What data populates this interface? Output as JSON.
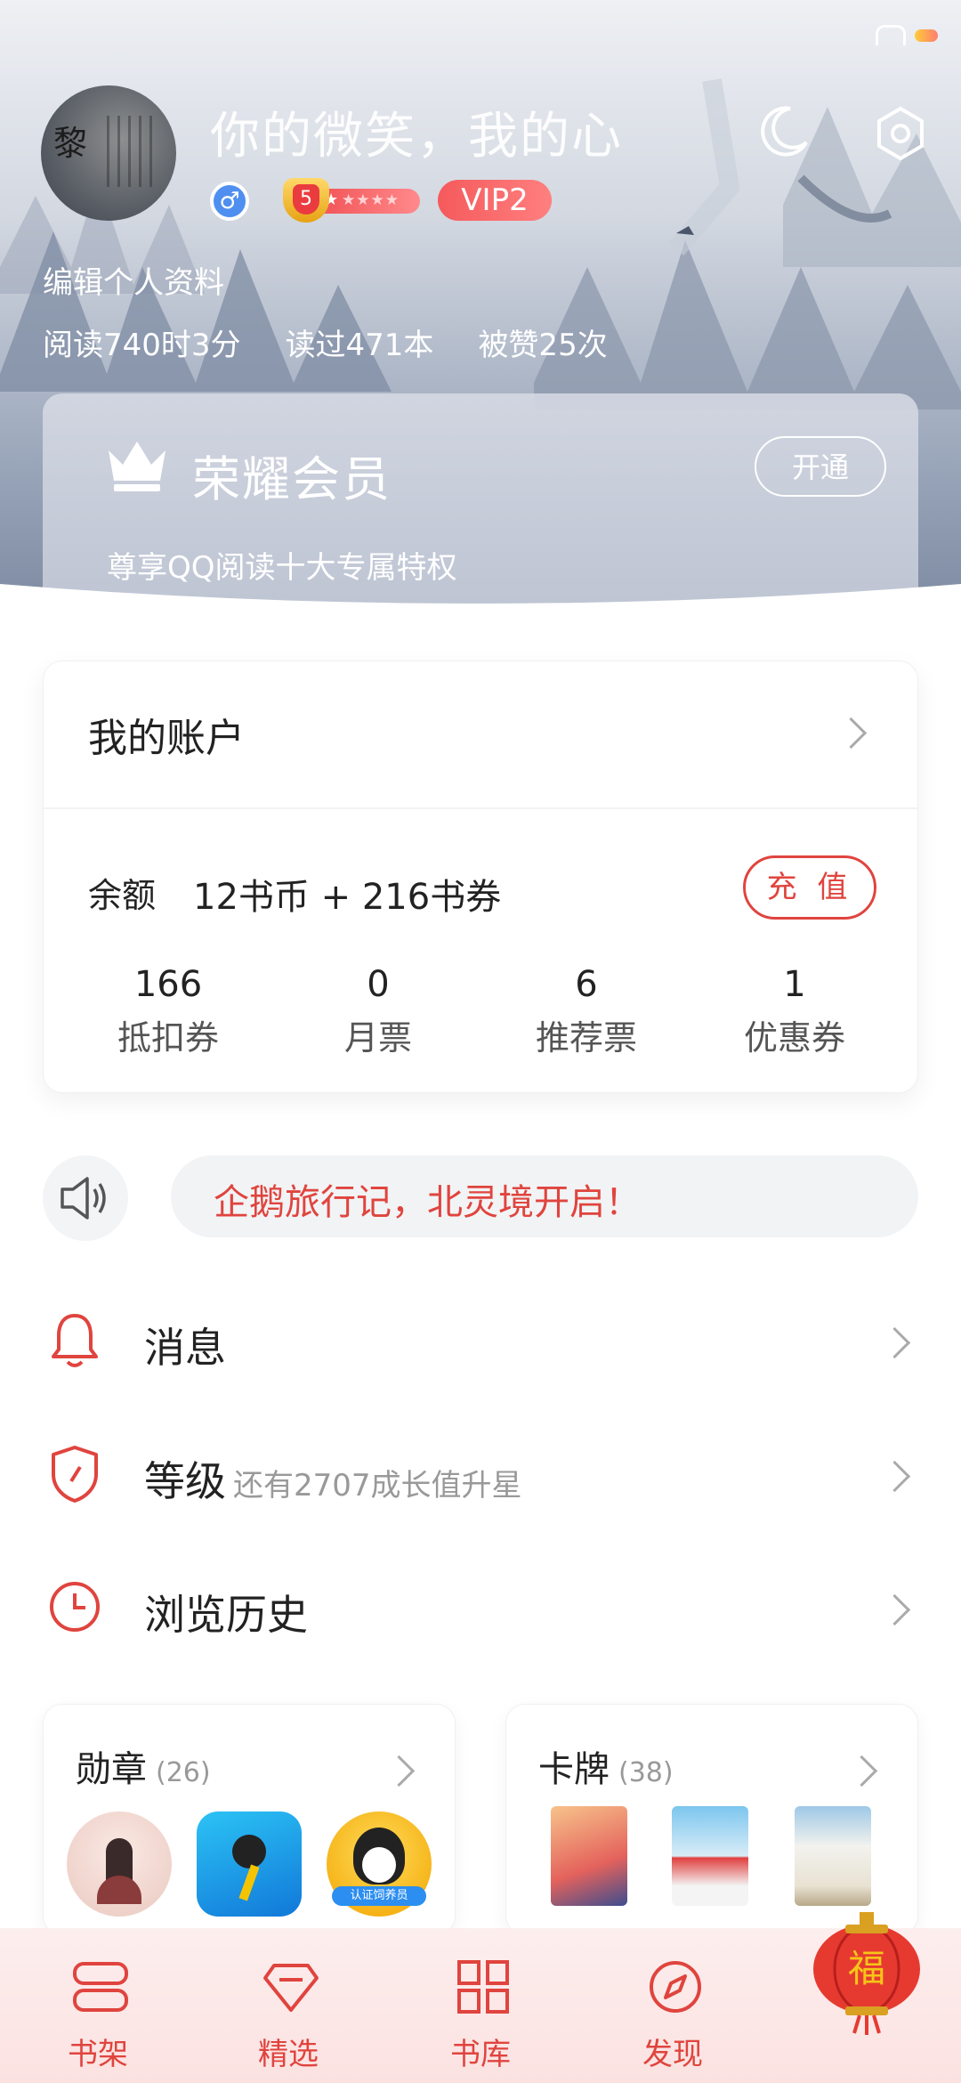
{
  "header": {
    "username": "你的微笑，我的心",
    "avatar_text": "黎",
    "gender_symbol": "♂",
    "level": "5",
    "vip": "VIP2",
    "edit_profile": "编辑个人资料",
    "stats": [
      "阅读740时3分",
      "读过471本",
      "被赞25次"
    ]
  },
  "member": {
    "title": "荣耀会员",
    "open_label": "开通",
    "subtitle": "尊享QQ阅读十大专属特权"
  },
  "account": {
    "title": "我的账户",
    "balance_label": "余额",
    "balance_value": "12书币 + 216书券",
    "recharge_label": "充 值",
    "tickets": [
      {
        "num": "166",
        "label": "抵扣券"
      },
      {
        "num": "0",
        "label": "月票"
      },
      {
        "num": "6",
        "label": "推荐票"
      },
      {
        "num": "1",
        "label": "优惠券"
      }
    ]
  },
  "notice": {
    "text": "企鹅旅行记，北灵境开启！"
  },
  "menu": [
    {
      "label": "消息",
      "hint": "",
      "icon": "bell-icon"
    },
    {
      "label": "等级",
      "hint": "还有2707成长值升星",
      "icon": "shield-icon"
    },
    {
      "label": "浏览历史",
      "hint": "",
      "icon": "clock-icon"
    }
  ],
  "collections": {
    "medals": {
      "title": "勋章",
      "count": "(26)",
      "medal3_text": "认证饲养员"
    },
    "cards": {
      "title": "卡牌",
      "count": "(38)"
    }
  },
  "tabs": [
    {
      "label": "书架",
      "icon": "bookshelf-icon"
    },
    {
      "label": "精选",
      "icon": "diamond-icon"
    },
    {
      "label": "书库",
      "icon": "grid-icon"
    },
    {
      "label": "发现",
      "icon": "compass-icon"
    }
  ],
  "lantern_text": "福",
  "colors": {
    "accent": "#e0443e",
    "vip": "#f55a5c",
    "tab_bg": "#fdeeee"
  }
}
